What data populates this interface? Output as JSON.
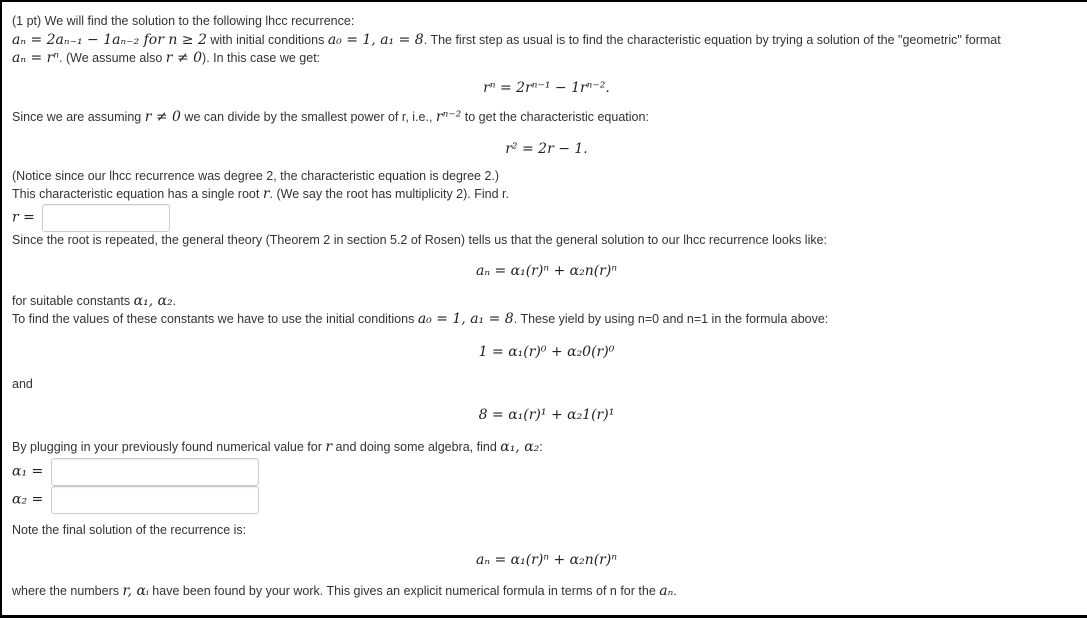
{
  "intro": {
    "line1": "(1 pt) We will find the solution to the following lhcc recurrence:",
    "recurrence_math": "aₙ = 2aₙ₋₁ − 1aₙ₋₂ for n ≥ 2",
    "line2_mid": " with initial conditions ",
    "init_math": "a₀ = 1, a₁ = 8",
    "line2_end": ". The first step as usual is to find the characteristic equation by trying a solution of the \"geometric\" format",
    "geom_math": "aₙ = rⁿ",
    "line3_mid": ". (We assume also ",
    "assume_math": "r ≠ 0",
    "line3_end": "). In this case we get:"
  },
  "eq1": "rⁿ = 2rⁿ⁻¹ − 1rⁿ⁻².",
  "divide": {
    "pre": "Since we are assuming ",
    "math1": "r ≠ 0",
    "mid": " we can divide by the smallest power of r, i.e., ",
    "math2": "rⁿ⁻²",
    "end": " to get the characteristic equation:"
  },
  "eq2": "r² = 2r − 1.",
  "notice": "(Notice since our lhcc recurrence was degree 2, the characteristic equation is degree 2.)",
  "single_root": {
    "pre": "This characteristic equation has a single root ",
    "math": "r",
    "end": ". (We say the root has multiplicity 2). Find r."
  },
  "r_label": "r =",
  "r_value": "",
  "repeated": "Since the root is repeated, the general theory (Theorem 2 in section 5.2 of Rosen) tells us that the general solution to our lhcc recurrence looks like:",
  "eq3": "aₙ = α₁(r)ⁿ + α₂n(r)ⁿ",
  "suitable": {
    "pre": "for suitable constants ",
    "math": "α₁, α₂",
    "end": "."
  },
  "tofind": {
    "pre": "To find the values of these constants we have to use the initial conditions ",
    "math": "a₀ = 1, a₁ = 8",
    "end": ". These yield by using n=0 and n=1 in the formula above:"
  },
  "eq4": "1 = α₁(r)⁰ + α₂0(r)⁰",
  "and": "and",
  "eq5": "8 = α₁(r)¹ + α₂1(r)¹",
  "plugging": {
    "pre": "By plugging in your previously found numerical value for ",
    "math1": "r",
    "mid": " and doing some algebra, find ",
    "math2": "α₁, α₂",
    "end": ":"
  },
  "alpha1_label": "α₁ =",
  "alpha1_value": "",
  "alpha2_label": "α₂ =",
  "alpha2_value": "",
  "note_final": "Note the final solution of the recurrence is:",
  "eq6": "aₙ = α₁(r)ⁿ + α₂n(r)ⁿ",
  "where": {
    "pre": "where the numbers ",
    "math": "r, αᵢ",
    "mid": " have been found by your work. This gives an explicit numerical formula in terms of n for the ",
    "math2": "aₙ",
    "end": "."
  }
}
